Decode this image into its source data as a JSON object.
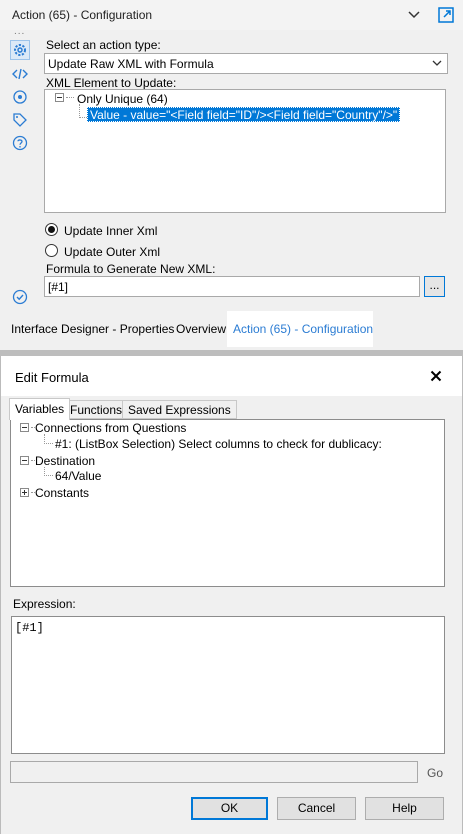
{
  "panel": {
    "title": "Action (65) - Configuration",
    "dots": "...",
    "action_type_label": "Select an action type:",
    "action_type_value": "Update Raw XML with Formula",
    "xml_element_label": "XML Element to Update:",
    "xml_tree_root": "Only Unique (64)",
    "xml_tree_selected": "Value - value=\"<Field field=\"ID\"/><Field field=\"Country\"/>\"",
    "radio_inner_label": "Update Inner Xml",
    "radio_outer_label": "Update Outer Xml",
    "formula_label": "Formula to Generate New XML:",
    "formula_value": "[#1]",
    "formula_button": "..."
  },
  "bottom_tabs": {
    "interface_designer": "Interface Designer - Properties",
    "overview": "Overview",
    "action_config": "Action (65) - Configuration"
  },
  "dialog": {
    "title": "Edit Formula",
    "tabs": [
      "Variables",
      "Functions",
      "Saved Expressions"
    ],
    "tree": {
      "connections": "Connections from Questions",
      "connections_child": "#1: (ListBox Selection) Select columns to check for dublicacy:",
      "destination": "Destination",
      "destination_child": "64/Value",
      "constants": "Constants"
    },
    "expression_label": "Expression:",
    "expression_value": "[#1]",
    "go_label": "Go",
    "ok": "OK",
    "cancel": "Cancel",
    "help": "Help"
  },
  "colors": {
    "accent": "#0078d7",
    "active_tab_text": "#2b7cd3"
  }
}
